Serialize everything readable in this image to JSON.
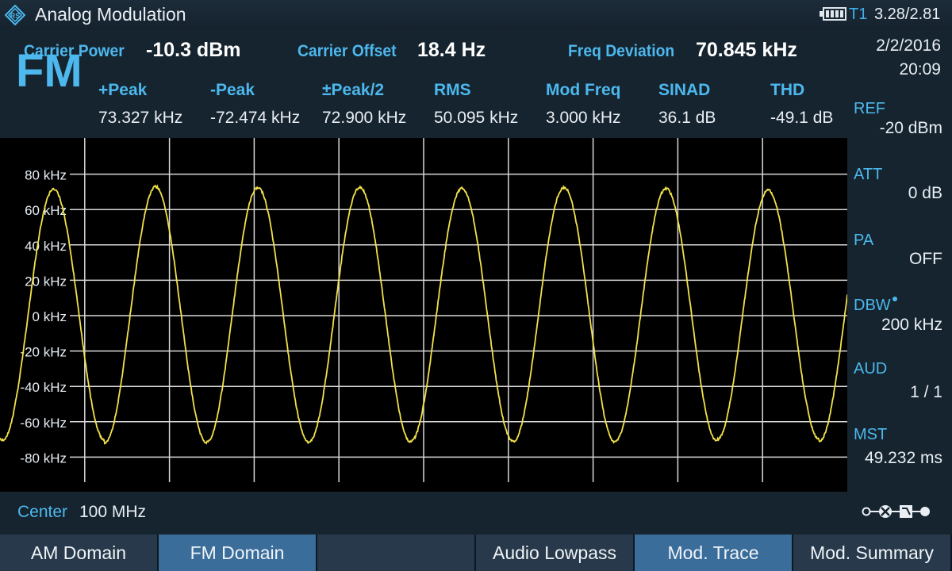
{
  "titlebar": {
    "title": "Analog Modulation",
    "trace": "T1",
    "version": "3.28/2.81",
    "logo_icon": "rs-diamond-logo-icon",
    "battery_icon": "battery-icon"
  },
  "header": {
    "carrier_power_label": "Carrier Power",
    "carrier_power_value": "-10.3 dBm",
    "carrier_offset_label": "Carrier Offset",
    "carrier_offset_value": "18.4 Hz",
    "freq_deviation_label": "Freq Deviation",
    "freq_deviation_value": "70.845 kHz",
    "modulation_type": "FM",
    "results": [
      {
        "label": "+Peak",
        "value": "73.327 kHz"
      },
      {
        "label": "-Peak",
        "value": "-72.474 kHz"
      },
      {
        "label": "±Peak/2",
        "value": "72.900 kHz"
      },
      {
        "label": "RMS",
        "value": "50.095 kHz"
      },
      {
        "label": "Mod Freq",
        "value": "3.000 kHz"
      },
      {
        "label": "SINAD",
        "value": "36.1 dB"
      },
      {
        "label": "THD",
        "value": "-49.1 dB"
      }
    ]
  },
  "right_panel": {
    "date": "2/2/2016",
    "time": "20:09",
    "items": [
      {
        "label": "REF",
        "value": "-20 dBm"
      },
      {
        "label": "ATT",
        "value": "0 dB"
      },
      {
        "label": "PA",
        "value": "OFF"
      },
      {
        "label": "DBW",
        "value": "200 kHz"
      },
      {
        "label": "AUD",
        "value": "1 / 1"
      },
      {
        "label": "MST",
        "value": "49.232 ms"
      }
    ],
    "connector_icon": "signal-path-icon"
  },
  "chart_data": {
    "type": "line",
    "y_tick_labels": [
      "80 kHz",
      "60 kHz",
      "40 kHz",
      "20 kHz",
      "0 kHz",
      "-20 kHz",
      "-40 kHz",
      "-60 kHz",
      "-80 kHz"
    ],
    "ylim": [
      -100,
      100
    ],
    "y_unit": "kHz",
    "grid": true,
    "series": [
      {
        "color": "#f2e24a",
        "waveform": "sine",
        "amplitude": 71,
        "offset": 0,
        "cycles": 8.3,
        "peak_values": [
          71,
          72.5,
          72,
          72,
          71.5,
          72,
          71.5,
          70.5,
          71.5
        ]
      }
    ]
  },
  "center": {
    "label": "Center",
    "value": "100 MHz"
  },
  "softkeys": [
    {
      "label": "AM Domain",
      "state": "normal"
    },
    {
      "label": "FM Domain",
      "state": "active"
    },
    {
      "label": "",
      "state": "normal"
    },
    {
      "label": "Audio Lowpass",
      "state": "normal"
    },
    {
      "label": "Mod. Trace",
      "state": "active"
    },
    {
      "label": "Mod. Summary",
      "state": "normal"
    }
  ],
  "colors": {
    "accent": "#4cb8ee",
    "trace": "#f2e24a",
    "active_softkey": "#3b6d9a",
    "panel": "#16242f"
  }
}
